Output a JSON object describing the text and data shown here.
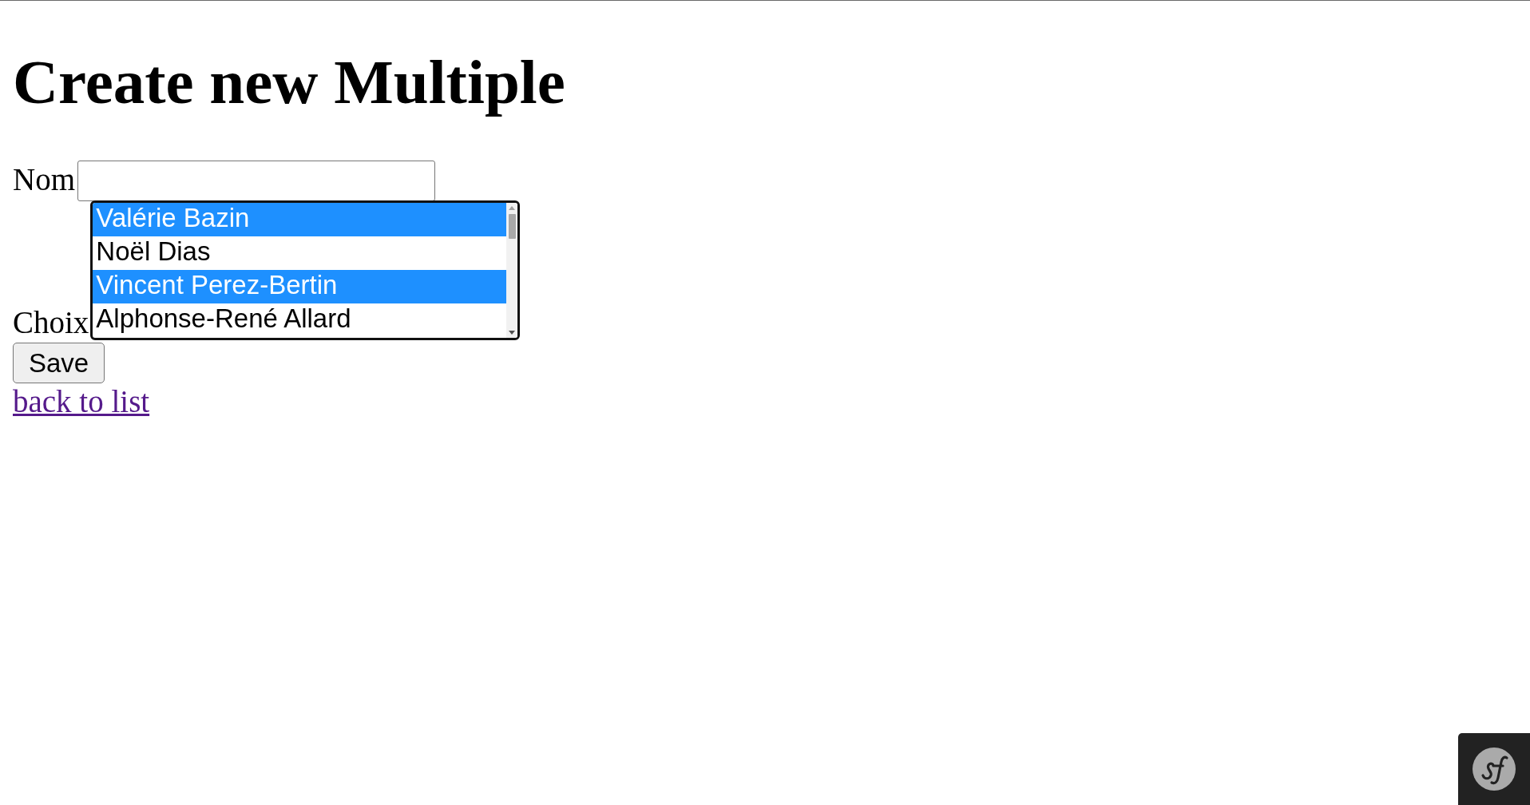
{
  "heading": "Create new Multiple",
  "form": {
    "fields": [
      {
        "kind": "text",
        "label": "Nom"
      },
      {
        "kind": "listbox",
        "label": "Choix",
        "focused": true,
        "options": [
          {
            "label": "Valérie Bazin",
            "selected": true
          },
          {
            "label": "Noël Dias",
            "selected": false
          },
          {
            "label": "Vincent Perez-Bertin",
            "selected": true
          },
          {
            "label": "Alphonse-René Allard",
            "selected": false
          }
        ]
      }
    ],
    "submit_button": "Save"
  },
  "back_link": {
    "label": "back to list",
    "visited": true
  }
}
